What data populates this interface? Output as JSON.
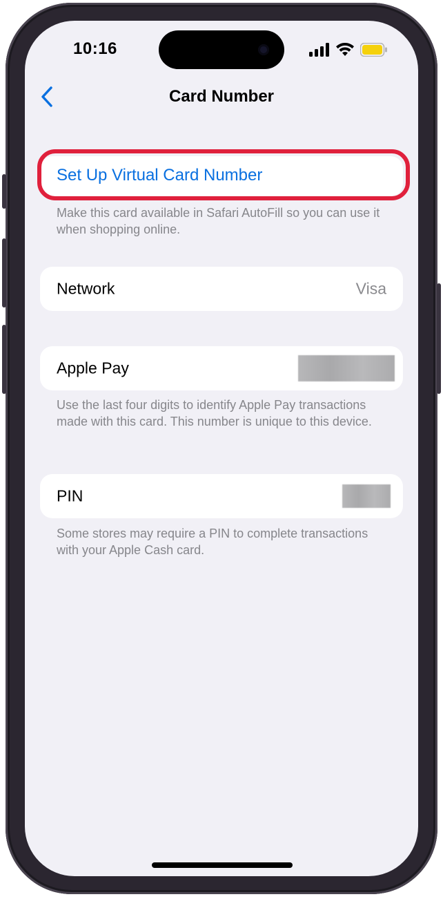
{
  "status_bar": {
    "time": "10:16",
    "icons": [
      "cellular-signal-icon",
      "wifi-icon",
      "battery-icon"
    ],
    "battery_color": "#f5d10c"
  },
  "nav": {
    "back_icon": "chevron-left-icon",
    "title": "Card Number"
  },
  "virtual_card": {
    "link_label": "Set Up Virtual Card Number",
    "footnote": "Make this card available in Safari AutoFill so you can use it when shopping online.",
    "highlight_color": "#e0203c"
  },
  "network": {
    "label": "Network",
    "value": "Visa"
  },
  "apple_pay": {
    "label": "Apple Pay",
    "value_redacted": true,
    "footnote": "Use the last four digits to identify Apple Pay transactions made with this card. This number is unique to this device."
  },
  "pin": {
    "label": "PIN",
    "value_redacted": true,
    "footnote": "Some stores may require a PIN to complete transactions with your Apple Cash card."
  },
  "colors": {
    "accent": "#0a70e0",
    "background": "#f1f0f6",
    "secondary_text": "#86868b"
  }
}
